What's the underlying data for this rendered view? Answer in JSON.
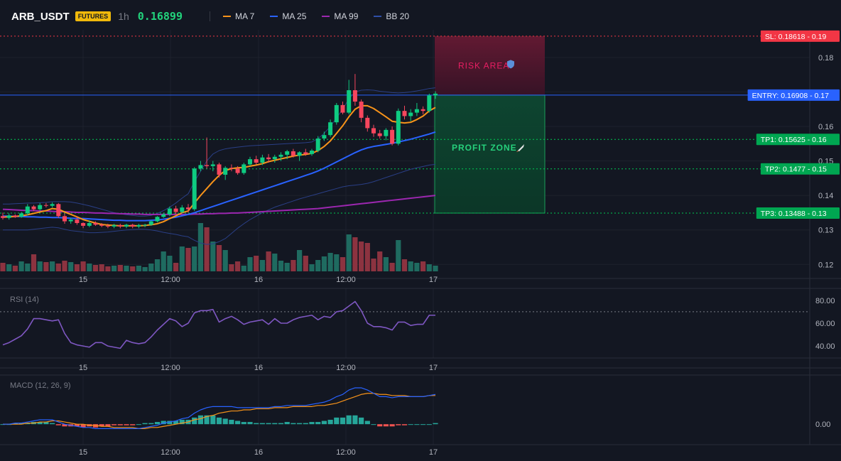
{
  "header": {
    "symbol": "ARB_USDT",
    "badge": "FUTURES",
    "timeframe": "1h",
    "last_price": "0.16899",
    "legend": [
      {
        "label": "MA 7",
        "color": "#f7931a"
      },
      {
        "label": "MA 25",
        "color": "#2962ff"
      },
      {
        "label": "MA 99",
        "color": "#9c27b0"
      },
      {
        "label": "BB 20",
        "color": "#1e3a8a"
      }
    ]
  },
  "levels": [
    {
      "label": "SL: 0.18618",
      "axis": "0.19",
      "price": 0.18618,
      "color": "#f23645",
      "style": "dotted"
    },
    {
      "label": "ENTRY: 0.16908",
      "axis": "0.17",
      "price": 0.16908,
      "color": "#2962ff",
      "style": "solid"
    },
    {
      "label": "TP1: 0.15625",
      "axis": "0.16",
      "price": 0.15625,
      "color": "#00c853",
      "style": "dotted"
    },
    {
      "label": "TP2: 0.1477",
      "axis": "0.15",
      "price": 0.1477,
      "color": "#00c853",
      "style": "dotted"
    },
    {
      "label": "TP3: 0.13488",
      "axis": "0.13",
      "price": 0.13488,
      "color": "#00c853",
      "style": "dotted"
    }
  ],
  "zones": {
    "risk_label": "RISK AREA",
    "profit_label": "PROFIT ZONE",
    "risk_icon": "shield-icon",
    "profit_icon": "rocket-icon"
  },
  "chart_data": [
    {
      "type": "candlestick",
      "title": "ARB_USDT 1h",
      "x_labels": [
        "15",
        "12:00",
        "16",
        "12:00",
        "17"
      ],
      "ylim": [
        0.118,
        0.188
      ],
      "y_ticks": [
        "0.18",
        "0.17",
        "0.16",
        "0.15",
        "0.14",
        "0.13",
        "0.12"
      ],
      "volume_up_color": "#1f6b60",
      "volume_down_color": "#8c3340",
      "ohlc": [
        [
          0.134,
          0.135,
          0.133,
          0.1335
        ],
        [
          0.1335,
          0.1348,
          0.133,
          0.1342
        ],
        [
          0.1342,
          0.1345,
          0.1335,
          0.1338
        ],
        [
          0.1338,
          0.1352,
          0.1335,
          0.1348
        ],
        [
          0.1348,
          0.1375,
          0.1342,
          0.1368
        ],
        [
          0.1368,
          0.1372,
          0.1355,
          0.136
        ],
        [
          0.136,
          0.1378,
          0.1355,
          0.1372
        ],
        [
          0.1372,
          0.1378,
          0.1365,
          0.137
        ],
        [
          0.137,
          0.138,
          0.1365,
          0.1375
        ],
        [
          0.1375,
          0.1378,
          0.1335,
          0.134
        ],
        [
          0.134,
          0.1348,
          0.1318,
          0.1325
        ],
        [
          0.1325,
          0.1335,
          0.1318,
          0.133
        ],
        [
          0.133,
          0.134,
          0.1315,
          0.132
        ],
        [
          0.132,
          0.1322,
          0.1305,
          0.1312
        ],
        [
          0.1312,
          0.1328,
          0.1308,
          0.132
        ],
        [
          0.132,
          0.1325,
          0.1312,
          0.1315
        ],
        [
          0.1315,
          0.132,
          0.1308,
          0.1312
        ],
        [
          0.1312,
          0.1318,
          0.1305,
          0.131
        ],
        [
          0.131,
          0.1318,
          0.1305,
          0.1314
        ],
        [
          0.1314,
          0.1318,
          0.1305,
          0.131
        ],
        [
          0.131,
          0.1318,
          0.1305,
          0.1315
        ],
        [
          0.1315,
          0.1318,
          0.1305,
          0.131
        ],
        [
          0.131,
          0.1318,
          0.1305,
          0.1314
        ],
        [
          0.1314,
          0.1318,
          0.1308,
          0.1315
        ],
        [
          0.1315,
          0.1328,
          0.1312,
          0.1325
        ],
        [
          0.1325,
          0.134,
          0.1322,
          0.1338
        ],
        [
          0.1338,
          0.135,
          0.1335,
          0.1345
        ],
        [
          0.1345,
          0.1368,
          0.134,
          0.1362
        ],
        [
          0.1362,
          0.137,
          0.1345,
          0.1352
        ],
        [
          0.1352,
          0.1372,
          0.1348,
          0.1365
        ],
        [
          0.1365,
          0.1375,
          0.135,
          0.136
        ],
        [
          0.136,
          0.1482,
          0.1355,
          0.1478
        ],
        [
          0.1478,
          0.15,
          0.147,
          0.1488
        ],
        [
          0.1488,
          0.1568,
          0.1478,
          0.1485
        ],
        [
          0.1485,
          0.15,
          0.147,
          0.149
        ],
        [
          0.149,
          0.1495,
          0.1452,
          0.146
        ],
        [
          0.146,
          0.1485,
          0.1445,
          0.148
        ],
        [
          0.148,
          0.149,
          0.147,
          0.1478
        ],
        [
          0.1478,
          0.1485,
          0.146,
          0.1465
        ],
        [
          0.1465,
          0.1495,
          0.146,
          0.149
        ],
        [
          0.149,
          0.1512,
          0.1485,
          0.1505
        ],
        [
          0.1505,
          0.1515,
          0.149,
          0.1495
        ],
        [
          0.1495,
          0.1518,
          0.1488,
          0.151
        ],
        [
          0.151,
          0.152,
          0.1495,
          0.1505
        ],
        [
          0.1505,
          0.1518,
          0.1495,
          0.1512
        ],
        [
          0.1512,
          0.1525,
          0.15,
          0.1518
        ],
        [
          0.1518,
          0.1532,
          0.1505,
          0.1528
        ],
        [
          0.1528,
          0.1535,
          0.151,
          0.1515
        ],
        [
          0.1515,
          0.1528,
          0.15,
          0.1525
        ],
        [
          0.1525,
          0.1535,
          0.1515,
          0.152
        ],
        [
          0.152,
          0.1535,
          0.1515,
          0.153
        ],
        [
          0.153,
          0.1572,
          0.1525,
          0.1565
        ],
        [
          0.1565,
          0.1585,
          0.1558,
          0.1575
        ],
        [
          0.1575,
          0.162,
          0.157,
          0.1612
        ],
        [
          0.1612,
          0.1668,
          0.1605,
          0.1662
        ],
        [
          0.1662,
          0.1672,
          0.1635,
          0.164
        ],
        [
          0.164,
          0.1735,
          0.1635,
          0.1705
        ],
        [
          0.1705,
          0.1752,
          0.166,
          0.1672
        ],
        [
          0.1672,
          0.1678,
          0.1612,
          0.1625
        ],
        [
          0.1625,
          0.1632,
          0.1585,
          0.1595
        ],
        [
          0.1595,
          0.1605,
          0.157,
          0.158
        ],
        [
          0.158,
          0.159,
          0.1565,
          0.1572
        ],
        [
          0.1572,
          0.1595,
          0.156,
          0.159
        ],
        [
          0.159,
          0.16,
          0.1545,
          0.155
        ],
        [
          0.155,
          0.1652,
          0.1545,
          0.1645
        ],
        [
          0.1645,
          0.166,
          0.162,
          0.163
        ],
        [
          0.163,
          0.165,
          0.1615,
          0.164
        ],
        [
          0.164,
          0.1668,
          0.163,
          0.165
        ],
        [
          0.165,
          0.1658,
          0.1635,
          0.1645
        ],
        [
          0.1645,
          0.1695,
          0.164,
          0.169
        ],
        [
          0.169,
          0.1702,
          0.168,
          0.1695
        ]
      ],
      "volume": [
        12,
        10,
        8,
        14,
        11,
        24,
        14,
        13,
        14,
        11,
        15,
        13,
        10,
        14,
        11,
        9,
        10,
        7,
        8,
        9,
        8,
        7,
        8,
        6,
        11,
        17,
        28,
        22,
        12,
        35,
        33,
        35,
        68,
        62,
        42,
        37,
        30,
        10,
        14,
        8,
        20,
        22,
        16,
        28,
        25,
        15,
        12,
        16,
        30,
        22,
        10,
        16,
        21,
        26,
        24,
        20,
        52,
        48,
        42,
        40,
        18,
        28,
        20,
        12,
        44,
        17,
        14,
        12,
        14,
        10,
        8
      ],
      "ma7": [
        0.1337,
        0.1338,
        0.1339,
        0.1341,
        0.1344,
        0.1348,
        0.1352,
        0.1356,
        0.1362,
        0.136,
        0.1352,
        0.1345,
        0.1338,
        0.133,
        0.1325,
        0.132,
        0.1316,
        0.1314,
        0.1313,
        0.1312,
        0.1312,
        0.1312,
        0.1312,
        0.1313,
        0.1315,
        0.1318,
        0.1324,
        0.1333,
        0.1341,
        0.135,
        0.1355,
        0.1378,
        0.14,
        0.142,
        0.144,
        0.1458,
        0.1472,
        0.1478,
        0.148,
        0.1481,
        0.1485,
        0.1488,
        0.1492,
        0.1498,
        0.1502,
        0.1506,
        0.151,
        0.1514,
        0.1517,
        0.1519,
        0.1522,
        0.153,
        0.1542,
        0.1558,
        0.158,
        0.1602,
        0.1628,
        0.165,
        0.166,
        0.166,
        0.1652,
        0.164,
        0.1628,
        0.1615,
        0.1612,
        0.161,
        0.1612,
        0.162,
        0.163,
        0.1645,
        0.1655
      ],
      "ma25": [
        0.134,
        0.134,
        0.1339,
        0.1339,
        0.1338,
        0.1338,
        0.1337,
        0.1337,
        0.1336,
        0.1336,
        0.1335,
        0.1334,
        0.1333,
        0.1333,
        0.1332,
        0.1331,
        0.133,
        0.1329,
        0.1328,
        0.1328,
        0.1327,
        0.1327,
        0.1327,
        0.1327,
        0.1328,
        0.1329,
        0.1331,
        0.1334,
        0.1337,
        0.1341,
        0.1345,
        0.135,
        0.1356,
        0.1362,
        0.1368,
        0.1374,
        0.138,
        0.1386,
        0.1392,
        0.1398,
        0.1404,
        0.141,
        0.1416,
        0.1422,
        0.1428,
        0.1434,
        0.144,
        0.1446,
        0.1452,
        0.1458,
        0.1464,
        0.1471,
        0.1479,
        0.1488,
        0.1497,
        0.1506,
        0.1515,
        0.1524,
        0.1532,
        0.1538,
        0.1542,
        0.1545,
        0.1548,
        0.1551,
        0.1555,
        0.1559,
        0.1563,
        0.1568,
        0.1573,
        0.1578,
        0.1584
      ],
      "ma99": [
        0.136,
        0.1359,
        0.1358,
        0.1357,
        0.1356,
        0.1356,
        0.1355,
        0.1355,
        0.1354,
        0.1353,
        0.1353,
        0.1352,
        0.1351,
        0.1351,
        0.135,
        0.1349,
        0.1349,
        0.1348,
        0.1348,
        0.1347,
        0.1347,
        0.1346,
        0.1346,
        0.1345,
        0.1345,
        0.1345,
        0.1345,
        0.1345,
        0.1345,
        0.1345,
        0.1345,
        0.1346,
        0.1346,
        0.1347,
        0.1347,
        0.1348,
        0.1348,
        0.1349,
        0.1349,
        0.135,
        0.1351,
        0.1352,
        0.1353,
        0.1354,
        0.1355,
        0.1356,
        0.1357,
        0.1358,
        0.1359,
        0.136,
        0.1361,
        0.1362,
        0.1364,
        0.1366,
        0.1368,
        0.137,
        0.1372,
        0.1374,
        0.1376,
        0.1378,
        0.138,
        0.1382,
        0.1384,
        0.1386,
        0.1388,
        0.139,
        0.1392,
        0.1394,
        0.1396,
        0.1398,
        0.14
      ],
      "bb_upper": [
        0.1375,
        0.1375,
        0.1376,
        0.1377,
        0.1378,
        0.1378,
        0.1379,
        0.138,
        0.1382,
        0.1382,
        0.1382,
        0.1381,
        0.1378,
        0.1374,
        0.137,
        0.1365,
        0.136,
        0.1355,
        0.135,
        0.1347,
        0.1344,
        0.1342,
        0.134,
        0.134,
        0.1342,
        0.1348,
        0.1356,
        0.1366,
        0.1378,
        0.1392,
        0.1405,
        0.144,
        0.147,
        0.15,
        0.152,
        0.153,
        0.1535,
        0.1538,
        0.154,
        0.1542,
        0.1544,
        0.1545,
        0.1546,
        0.1547,
        0.1548,
        0.1549,
        0.155,
        0.1551,
        0.1552,
        0.1553,
        0.1555,
        0.1565,
        0.158,
        0.16,
        0.1625,
        0.165,
        0.168,
        0.17,
        0.1705,
        0.1706,
        0.1705,
        0.1702,
        0.17,
        0.1698,
        0.1697,
        0.1698,
        0.17,
        0.1703,
        0.1706,
        0.171,
        0.1712
      ],
      "bb_lower": [
        0.13,
        0.13,
        0.13,
        0.13,
        0.13,
        0.1302,
        0.1304,
        0.1306,
        0.1308,
        0.1306,
        0.1302,
        0.1298,
        0.1296,
        0.1294,
        0.1292,
        0.1292,
        0.1293,
        0.1294,
        0.1296,
        0.1298,
        0.13,
        0.1301,
        0.1302,
        0.1302,
        0.13,
        0.1297,
        0.1293,
        0.129,
        0.1287,
        0.1283,
        0.128,
        0.127,
        0.1262,
        0.1258,
        0.126,
        0.1266,
        0.1275,
        0.129,
        0.1305,
        0.1318,
        0.133,
        0.134,
        0.135,
        0.1358,
        0.1366,
        0.1372,
        0.1378,
        0.1384,
        0.139,
        0.1395,
        0.14,
        0.1405,
        0.141,
        0.1415,
        0.142,
        0.1425,
        0.1428,
        0.143,
        0.1432,
        0.1435,
        0.144,
        0.1446,
        0.1452,
        0.1458,
        0.1464,
        0.147,
        0.1476,
        0.148,
        0.1484,
        0.1488,
        0.149
      ]
    },
    {
      "type": "line",
      "title": "RSI (14)",
      "y_ticks": [
        "80.00",
        "60.00",
        "40.00"
      ],
      "ylim": [
        32,
        88
      ],
      "overbought": 70,
      "color": "#7e57c2",
      "values": [
        41,
        43,
        46,
        49,
        55,
        64,
        64,
        63,
        62,
        63,
        51,
        43,
        41,
        40,
        39,
        43,
        43,
        40,
        39,
        38,
        45,
        43,
        42,
        43,
        48,
        54,
        59,
        64,
        62,
        57,
        60,
        69,
        71,
        71,
        72,
        61,
        64,
        66,
        63,
        59,
        61,
        62,
        63,
        59,
        64,
        60,
        60,
        63,
        65,
        66,
        67,
        63,
        66,
        65,
        70,
        71,
        75,
        79,
        71,
        60,
        57,
        57,
        56,
        54,
        61,
        61,
        58,
        59,
        59,
        67,
        67
      ]
    },
    {
      "type": "line",
      "title": "MACD (12, 26, 9)",
      "y_ticks": [
        "0.00"
      ],
      "ylim": [
        -0.0016,
        0.0042
      ],
      "macd_color": "#2962ff",
      "signal_color": "#f7931a",
      "hist_up_color": "#26a69a",
      "hist_down_color": "#ef5350",
      "macd": [
        0.0,
        0.0,
        0.0001,
        0.0001,
        0.0002,
        0.0003,
        0.0004,
        0.0004,
        0.0004,
        0.0002,
        0.0,
        -0.0001,
        -0.0002,
        -0.0003,
        -0.0003,
        -0.0004,
        -0.0004,
        -0.0004,
        -0.0004,
        -0.0004,
        -0.0004,
        -0.0004,
        -0.0004,
        -0.0003,
        -0.0002,
        -0.0001,
        0.0001,
        0.0002,
        0.0003,
        0.0005,
        0.0006,
        0.001,
        0.0013,
        0.0015,
        0.0016,
        0.0016,
        0.0016,
        0.0016,
        0.0015,
        0.0015,
        0.0015,
        0.0015,
        0.0015,
        0.0015,
        0.0016,
        0.0016,
        0.0017,
        0.0017,
        0.0017,
        0.0017,
        0.0018,
        0.0019,
        0.002,
        0.0022,
        0.0025,
        0.0027,
        0.0031,
        0.0033,
        0.0033,
        0.0031,
        0.0028,
        0.0025,
        0.0025,
        0.0024,
        0.0025,
        0.0025,
        0.0025,
        0.0025,
        0.0025,
        0.0026,
        0.0027
      ],
      "signal": [
        0.0,
        0.0,
        0.0,
        0.0,
        0.0001,
        0.0001,
        0.0002,
        0.0002,
        0.0003,
        0.0003,
        0.0002,
        0.0001,
        0.0,
        0.0,
        -0.0001,
        -0.0001,
        -0.0002,
        -0.0002,
        -0.0003,
        -0.0003,
        -0.0003,
        -0.0003,
        -0.0004,
        -0.0004,
        -0.0003,
        -0.0003,
        -0.0002,
        -0.0001,
        0.0,
        0.0001,
        0.0002,
        0.0004,
        0.0005,
        0.0007,
        0.0008,
        0.001,
        0.0011,
        0.0012,
        0.0012,
        0.0013,
        0.0013,
        0.0014,
        0.0014,
        0.0014,
        0.0015,
        0.0015,
        0.0015,
        0.0016,
        0.0016,
        0.0016,
        0.0016,
        0.0017,
        0.0017,
        0.0018,
        0.0019,
        0.0021,
        0.0023,
        0.0025,
        0.0027,
        0.0028,
        0.0028,
        0.0027,
        0.0027,
        0.0026,
        0.0026,
        0.0026,
        0.0025,
        0.0025,
        0.0025,
        0.0026,
        0.0026
      ]
    }
  ]
}
